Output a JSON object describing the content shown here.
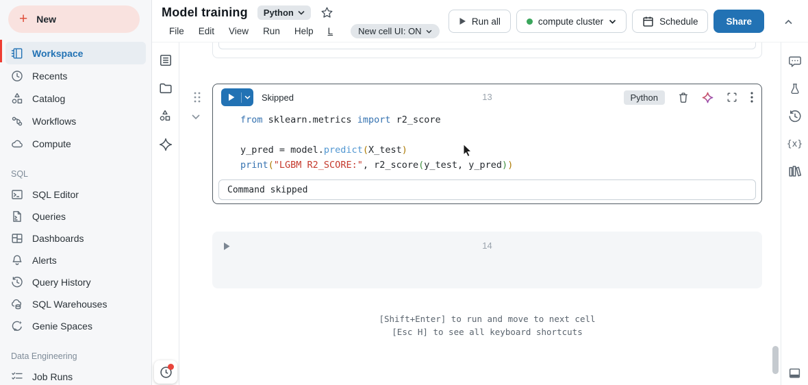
{
  "sidebar": {
    "new_button_label": "New",
    "main_items": [
      {
        "label": "Workspace",
        "icon": "workspace-icon",
        "active": true
      },
      {
        "label": "Recents",
        "icon": "recents-clock-icon",
        "active": false
      },
      {
        "label": "Catalog",
        "icon": "catalog-icon",
        "active": false
      },
      {
        "label": "Workflows",
        "icon": "workflows-icon",
        "active": false
      },
      {
        "label": "Compute",
        "icon": "compute-cloud-icon",
        "active": false
      }
    ],
    "sections": [
      {
        "title": "SQL",
        "items": [
          {
            "label": "SQL Editor",
            "icon": "sql-editor-icon"
          },
          {
            "label": "Queries",
            "icon": "queries-icon"
          },
          {
            "label": "Dashboards",
            "icon": "dashboards-icon"
          },
          {
            "label": "Alerts",
            "icon": "alerts-bell-icon"
          },
          {
            "label": "Query History",
            "icon": "query-history-icon"
          },
          {
            "label": "SQL Warehouses",
            "icon": "sql-warehouses-icon"
          },
          {
            "label": "Genie Spaces",
            "icon": "genie-spaces-icon"
          }
        ]
      },
      {
        "title": "Data Engineering",
        "items": [
          {
            "label": "Job Runs",
            "icon": "job-runs-icon"
          }
        ]
      }
    ]
  },
  "header": {
    "title": "Model training",
    "language_selector": "Python",
    "menu_items": [
      "File",
      "Edit",
      "View",
      "Run",
      "Help",
      "L"
    ],
    "new_cell_ui_label": "New cell UI: ON",
    "actions": {
      "run_all": "Run all",
      "cluster": "compute cluster",
      "schedule": "Schedule",
      "share": "Share"
    }
  },
  "notebook": {
    "cell13": {
      "status": "Skipped",
      "number": "13",
      "language": "Python",
      "code_lines": [
        [
          {
            "t": "from",
            "c": "kw"
          },
          {
            "t": " sklearn.metrics ",
            "c": "pl"
          },
          {
            "t": "import",
            "c": "kw"
          },
          {
            "t": " r2_score",
            "c": "pl"
          }
        ],
        [],
        [
          {
            "t": "y_pred = model.",
            "c": "pl"
          },
          {
            "t": "predict",
            "c": "fn"
          },
          {
            "t": "(",
            "c": "b1"
          },
          {
            "t": "X_test",
            "c": "pl"
          },
          {
            "t": ")",
            "c": "b1"
          }
        ],
        [
          {
            "t": "print",
            "c": "kw"
          },
          {
            "t": "(",
            "c": "b1"
          },
          {
            "t": "\"LGBM R2_SCORE:\"",
            "c": "st"
          },
          {
            "t": ", r2_score",
            "c": "pl"
          },
          {
            "t": "(",
            "c": "b2"
          },
          {
            "t": "y_test, y_pred",
            "c": "pl"
          },
          {
            "t": ")",
            "c": "b2"
          },
          {
            "t": ")",
            "c": "b1"
          }
        ]
      ],
      "output": "Command skipped"
    },
    "cell14": {
      "number": "14"
    },
    "hints": [
      "[Shift+Enter] to run and move to next cell",
      "[Esc H] to see all keyboard shortcuts"
    ]
  },
  "left_strip_icons": [
    "table-of-contents-icon",
    "folder-icon",
    "catalog-icon",
    "assistant-sparkle-icon"
  ],
  "right_rail_icons": [
    "comments-icon",
    "experiments-icon",
    "version-history-icon",
    "variables-icon",
    "libraries-icon"
  ],
  "colors": {
    "accent_blue": "#2272B4",
    "brand_red": "#EE3D33",
    "cluster_status_green": "#3BA65C"
  }
}
